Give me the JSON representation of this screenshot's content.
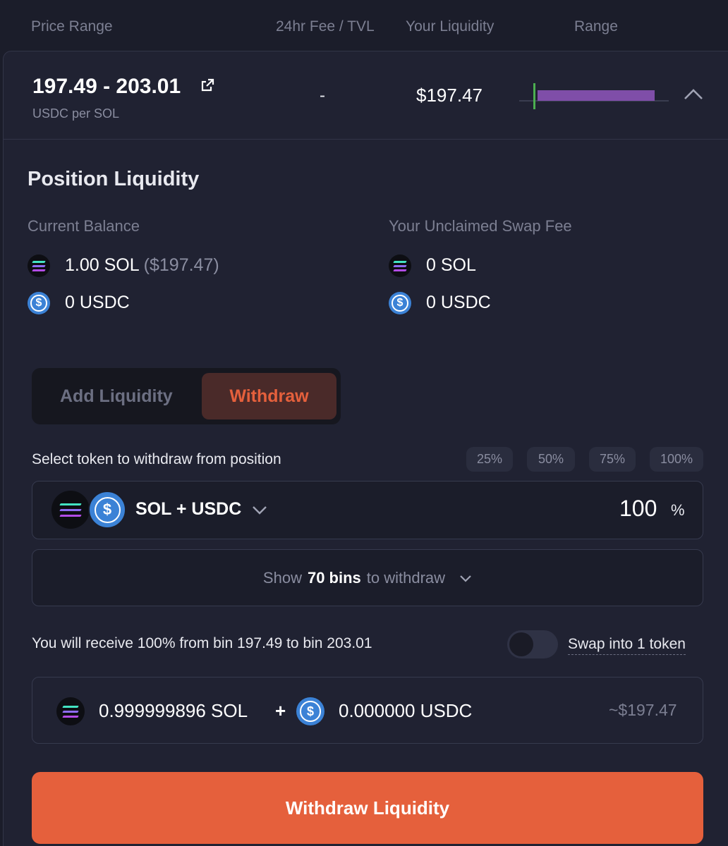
{
  "header": {
    "price_range": "Price Range",
    "fee_tvl": "24hr Fee / TVL",
    "your_liquidity": "Your Liquidity",
    "range": "Range"
  },
  "position": {
    "price_range": "197.49 - 203.01",
    "unit": "USDC per SOL",
    "fee_tvl_value": "-",
    "liquidity_value": "$197.47"
  },
  "section": {
    "title": "Position Liquidity"
  },
  "current_balance": {
    "label": "Current Balance",
    "sol_amount": "1.00 SOL",
    "sol_usd": "($197.47)",
    "usdc_amount": "0 USDC"
  },
  "unclaimed_fee": {
    "label": "Your Unclaimed Swap Fee",
    "sol_amount": "0 SOL",
    "usdc_amount": "0 USDC"
  },
  "tabs": {
    "add": "Add Liquidity",
    "withdraw": "Withdraw"
  },
  "withdraw": {
    "select_label": "Select token to withdraw from position",
    "presets": [
      "25%",
      "50%",
      "75%",
      "100%"
    ],
    "token_pair": "SOL + USDC",
    "percent_value": "100",
    "percent_symbol": "%",
    "bins_prefix": "Show",
    "bins_count": "70 bins",
    "bins_suffix": "to withdraw",
    "receive_text": "You will receive 100% from bin 197.49 to bin 203.01",
    "swap_toggle_label": "Swap into 1 token",
    "swap_toggle_on": false,
    "receive_sol": "0.999999896 SOL",
    "plus": "+",
    "receive_usdc": "0.000000 USDC",
    "receive_usd": "~$197.47",
    "action_button": "Withdraw Liquidity"
  },
  "colors": {
    "accent": "#e5603c",
    "range_bar": "#7f4ea8",
    "current_price_marker": "#4caf50"
  }
}
